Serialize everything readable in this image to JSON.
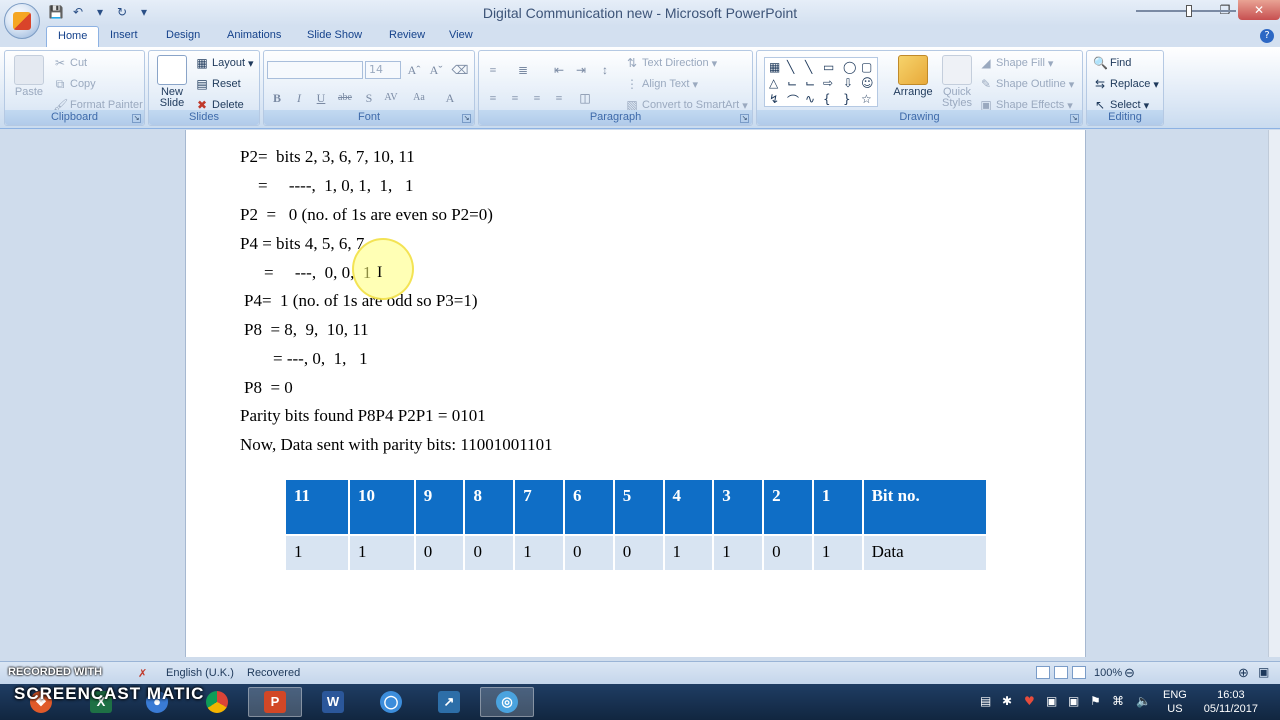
{
  "window": {
    "title": "Digital Communication new - Microsoft PowerPoint"
  },
  "tabs": [
    "Home",
    "Insert",
    "Design",
    "Animations",
    "Slide Show",
    "Review",
    "View"
  ],
  "ribbon": {
    "clipboard": {
      "label": "Clipboard",
      "paste": "Paste",
      "cut": "Cut",
      "copy": "Copy",
      "format_painter": "Format Painter"
    },
    "slides": {
      "label": "Slides",
      "new_slide": "New Slide",
      "layout": "Layout",
      "reset": "Reset",
      "delete": "Delete"
    },
    "font": {
      "label": "Font",
      "size": "14"
    },
    "paragraph": {
      "label": "Paragraph",
      "text_direction": "Text Direction",
      "align_text": "Align Text",
      "convert_smartart": "Convert to SmartArt"
    },
    "drawing": {
      "label": "Drawing",
      "arrange": "Arrange",
      "quick_styles": "Quick Styles",
      "shape_fill": "Shape Fill",
      "shape_outline": "Shape Outline",
      "shape_effects": "Shape Effects"
    },
    "editing": {
      "label": "Editing",
      "find": "Find",
      "replace": "Replace",
      "select": "Select"
    }
  },
  "slide": {
    "lines": [
      "P2=  bits 2, 3, 6, 7, 10, 11",
      "=     ----,  1, 0, 1,  1,   1",
      "P2  =   0 (no. of 1s are even so P2=0)",
      "P4 = bits 4, 5, 6, 7",
      "=     ---,  0, 0,  1",
      "P4=  1 (no. of 1s are odd so P3=1)",
      "P8  = 8,  9,  10, 11",
      "= ---, 0,  1,   1",
      "P8  = 0",
      "Parity bits found P8P4 P2P1 = 0101",
      "Now, Data sent with parity bits: 11001001101"
    ],
    "table": {
      "header": [
        "11",
        "10",
        "9",
        "8",
        "7",
        "6",
        "5",
        "4",
        "3",
        "2",
        "1",
        "Bit no."
      ],
      "row": [
        "1",
        "1",
        "0",
        "0",
        "1",
        "0",
        "0",
        "1",
        "1",
        "0",
        "1",
        "Data"
      ]
    }
  },
  "statusbar": {
    "language": "English (U.K.)",
    "status": "Recovered",
    "zoom": "100%"
  },
  "watermark": {
    "line1": "RECORDED WITH",
    "line2": "SCREENCAST  MATIC"
  },
  "taskbar": {
    "lang_top": "ENG",
    "lang_bottom": "US",
    "time": "16:03",
    "date": "05/11/2017"
  },
  "colors": {
    "table_header": "#0f6ec6",
    "table_body": "#d8e4f2",
    "ribbon_bg": "#dbe7f5"
  }
}
